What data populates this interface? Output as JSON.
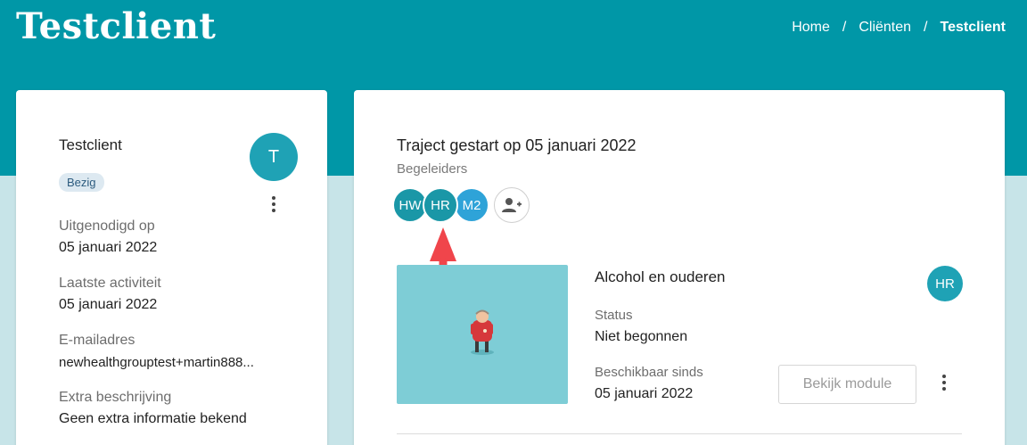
{
  "header": {
    "title": "Testclient",
    "breadcrumb": [
      {
        "label": "Home"
      },
      {
        "label": "Cliënten"
      },
      {
        "label": "Testclient"
      }
    ],
    "separator": "/",
    "color": "#0097a7"
  },
  "client": {
    "name": "Testclient",
    "status_badge": "Bezig",
    "avatar_initial": "T",
    "fields": [
      {
        "label": "Uitgenodigd op",
        "value": "05 januari 2022"
      },
      {
        "label": "Laatste activiteit",
        "value": "05 januari 2022"
      },
      {
        "label": "E-mailadres",
        "value": "newhealthgrouptest+martin888..."
      },
      {
        "label": "Extra beschrijving",
        "value": "Geen extra informatie bekend"
      }
    ]
  },
  "traject": {
    "title": "Traject gestart op 05 januari 2022",
    "coaches_label": "Begeleiders",
    "coaches": [
      {
        "initials": "HW"
      },
      {
        "initials": "HR"
      },
      {
        "initials": "M2"
      }
    ],
    "add_coach_icon": "add-user-icon"
  },
  "module": {
    "title": "Alcohol en ouderen",
    "assignee_initials": "HR",
    "status_label": "Status",
    "status_value": "Niet begonnen",
    "available_label": "Beschikbaar sinds",
    "available_value": "05 januari 2022",
    "view_button": "Bekijk module",
    "image_color": "#7ecdd6"
  },
  "annotation": {
    "color": "#f0454b"
  }
}
